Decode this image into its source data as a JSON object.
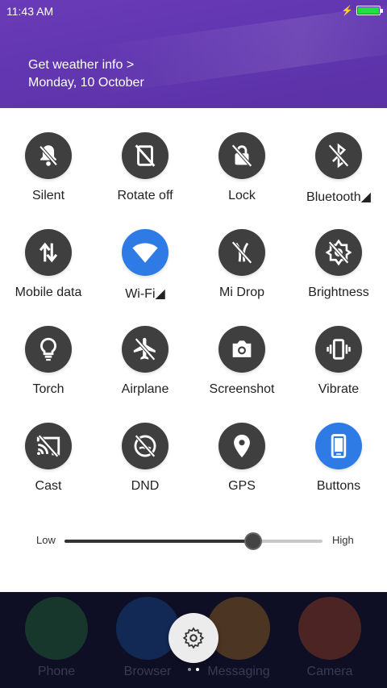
{
  "status": {
    "time": "11:43 AM"
  },
  "header": {
    "weather": "Get weather info >",
    "date": "Monday, 10 October"
  },
  "tiles": [
    {
      "label": "Silent",
      "icon": "silent-icon",
      "active": false
    },
    {
      "label": "Rotate off",
      "icon": "rotate-off-icon",
      "active": false
    },
    {
      "label": "Lock",
      "icon": "lock-icon",
      "active": false
    },
    {
      "label": "Bluetooth◢",
      "icon": "bluetooth-icon",
      "active": false
    },
    {
      "label": "Mobile data",
      "icon": "mobile-data-icon",
      "active": false
    },
    {
      "label": "Wi-Fi◢",
      "icon": "wifi-icon",
      "active": true
    },
    {
      "label": "Mi Drop",
      "icon": "mi-drop-icon",
      "active": false
    },
    {
      "label": "Brightness",
      "icon": "brightness-icon",
      "active": false
    },
    {
      "label": "Torch",
      "icon": "torch-icon",
      "active": false
    },
    {
      "label": "Airplane",
      "icon": "airplane-icon",
      "active": false
    },
    {
      "label": "Screenshot",
      "icon": "screenshot-icon",
      "active": false
    },
    {
      "label": "Vibrate",
      "icon": "vibrate-icon",
      "active": false
    },
    {
      "label": "Cast",
      "icon": "cast-icon",
      "active": false
    },
    {
      "label": "DND",
      "icon": "dnd-icon",
      "active": false
    },
    {
      "label": "GPS",
      "icon": "gps-icon",
      "active": false
    },
    {
      "label": "Buttons",
      "icon": "buttons-icon",
      "active": true
    }
  ],
  "brightness": {
    "low": "Low",
    "high": "High",
    "level": 0.73
  },
  "dock": {
    "apps": [
      {
        "label": "Phone",
        "color": "#2ea043"
      },
      {
        "label": "Browser",
        "color": "#1e6fd9"
      },
      {
        "label": "Messaging",
        "color": "#f29c1f"
      },
      {
        "label": "Camera",
        "color": "#e85d1f"
      }
    ]
  },
  "colors": {
    "accent": "#2f7be6",
    "tile": "#3f3f3f",
    "header": "#6236b0"
  }
}
